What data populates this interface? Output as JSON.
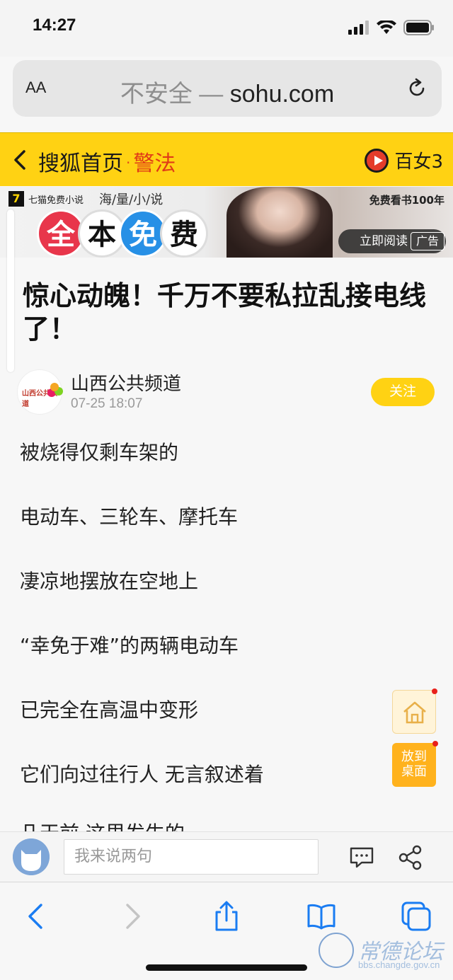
{
  "status_bar": {
    "time": "14:27"
  },
  "browser": {
    "text_size_label": "AA",
    "url_insecure": "不安全",
    "url_separator": "—",
    "url_domain": "sohu.com"
  },
  "sohu_nav": {
    "home_label": "搜狐首页",
    "dot": "·",
    "section_label": "警法",
    "right_label": "百女3"
  },
  "ad": {
    "brand": "七猫免费小说",
    "slogan": "海/量/小/说",
    "characters": [
      "全",
      "本",
      "免",
      "费"
    ],
    "free_books": "免费看书100年",
    "read_now": "立即阅读",
    "ad_tag": "广告"
  },
  "article": {
    "title": "惊心动魄！千万不要私拉乱接电线了！",
    "author": "山西公共频道",
    "author_logo_text": "山西公共频道",
    "time": "07-25 18:07",
    "follow_label": "关注",
    "paragraphs": [
      "被烧得仅剩车架的",
      "电动车、三轮车、摩托车",
      "凄凉地摆放在空地上",
      "“幸免于难”的两辆电动车",
      "已完全在高温中变形",
      "它们向过往行人 无言叙述着"
    ],
    "cut_paragraph": "几天前 这里发生的"
  },
  "floating": {
    "desktop_label_1": "放到",
    "desktop_label_2": "桌面"
  },
  "comment_bar": {
    "placeholder": "我来说两句"
  },
  "watermark": {
    "text": "常德论坛",
    "url": "bbs.changde.gov.cn"
  },
  "colors": {
    "sohu_yellow": "#ffd213",
    "accent_red": "#e03a17",
    "link_blue": "#1a7cf2"
  }
}
